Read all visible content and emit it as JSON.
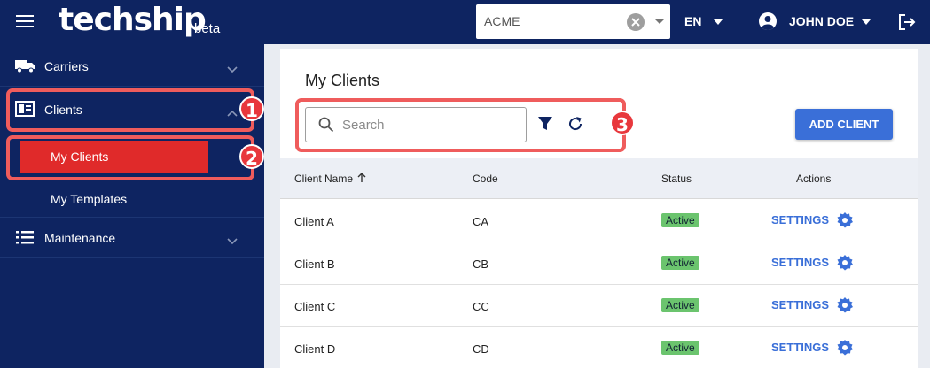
{
  "app": {
    "logo_text": "techship",
    "logo_suffix": "beta"
  },
  "topbar": {
    "client_select_value": "ACME",
    "language": "EN",
    "user_name": "JOHN DOE"
  },
  "sidebar": {
    "items": [
      {
        "label": "Carriers",
        "icon": "truck-icon",
        "expanded": false
      },
      {
        "label": "Clients",
        "icon": "contact-card-icon",
        "expanded": true
      },
      {
        "label": "Maintenance",
        "icon": "list-icon",
        "expanded": false
      }
    ],
    "sub_items": [
      {
        "label": "My Clients",
        "active": true
      },
      {
        "label": "My Templates",
        "active": false
      }
    ]
  },
  "annotations": {
    "badge_1": "1",
    "badge_2": "2",
    "badge_3": "3",
    "color": "#ef5c5c"
  },
  "main": {
    "title": "My Clients",
    "search_placeholder": "Search",
    "add_button": "ADD CLIENT",
    "table": {
      "columns": [
        "Client Name",
        "Code",
        "Status",
        "Actions"
      ],
      "sort_indicator": "arrow-up-icon",
      "rows": [
        {
          "name": "Client A",
          "code": "CA",
          "status": "Active",
          "action": "SETTINGS"
        },
        {
          "name": "Client B",
          "code": "CB",
          "status": "Active",
          "action": "SETTINGS"
        },
        {
          "name": "Client C",
          "code": "CC",
          "status": "Active",
          "action": "SETTINGS"
        },
        {
          "name": "Client D",
          "code": "CD",
          "status": "Active",
          "action": "SETTINGS"
        }
      ]
    }
  },
  "colors": {
    "navy": "#0e2461",
    "accent_blue": "#3a6fd8",
    "active_red": "#e02a2a",
    "status_green": "#6bc46e"
  }
}
